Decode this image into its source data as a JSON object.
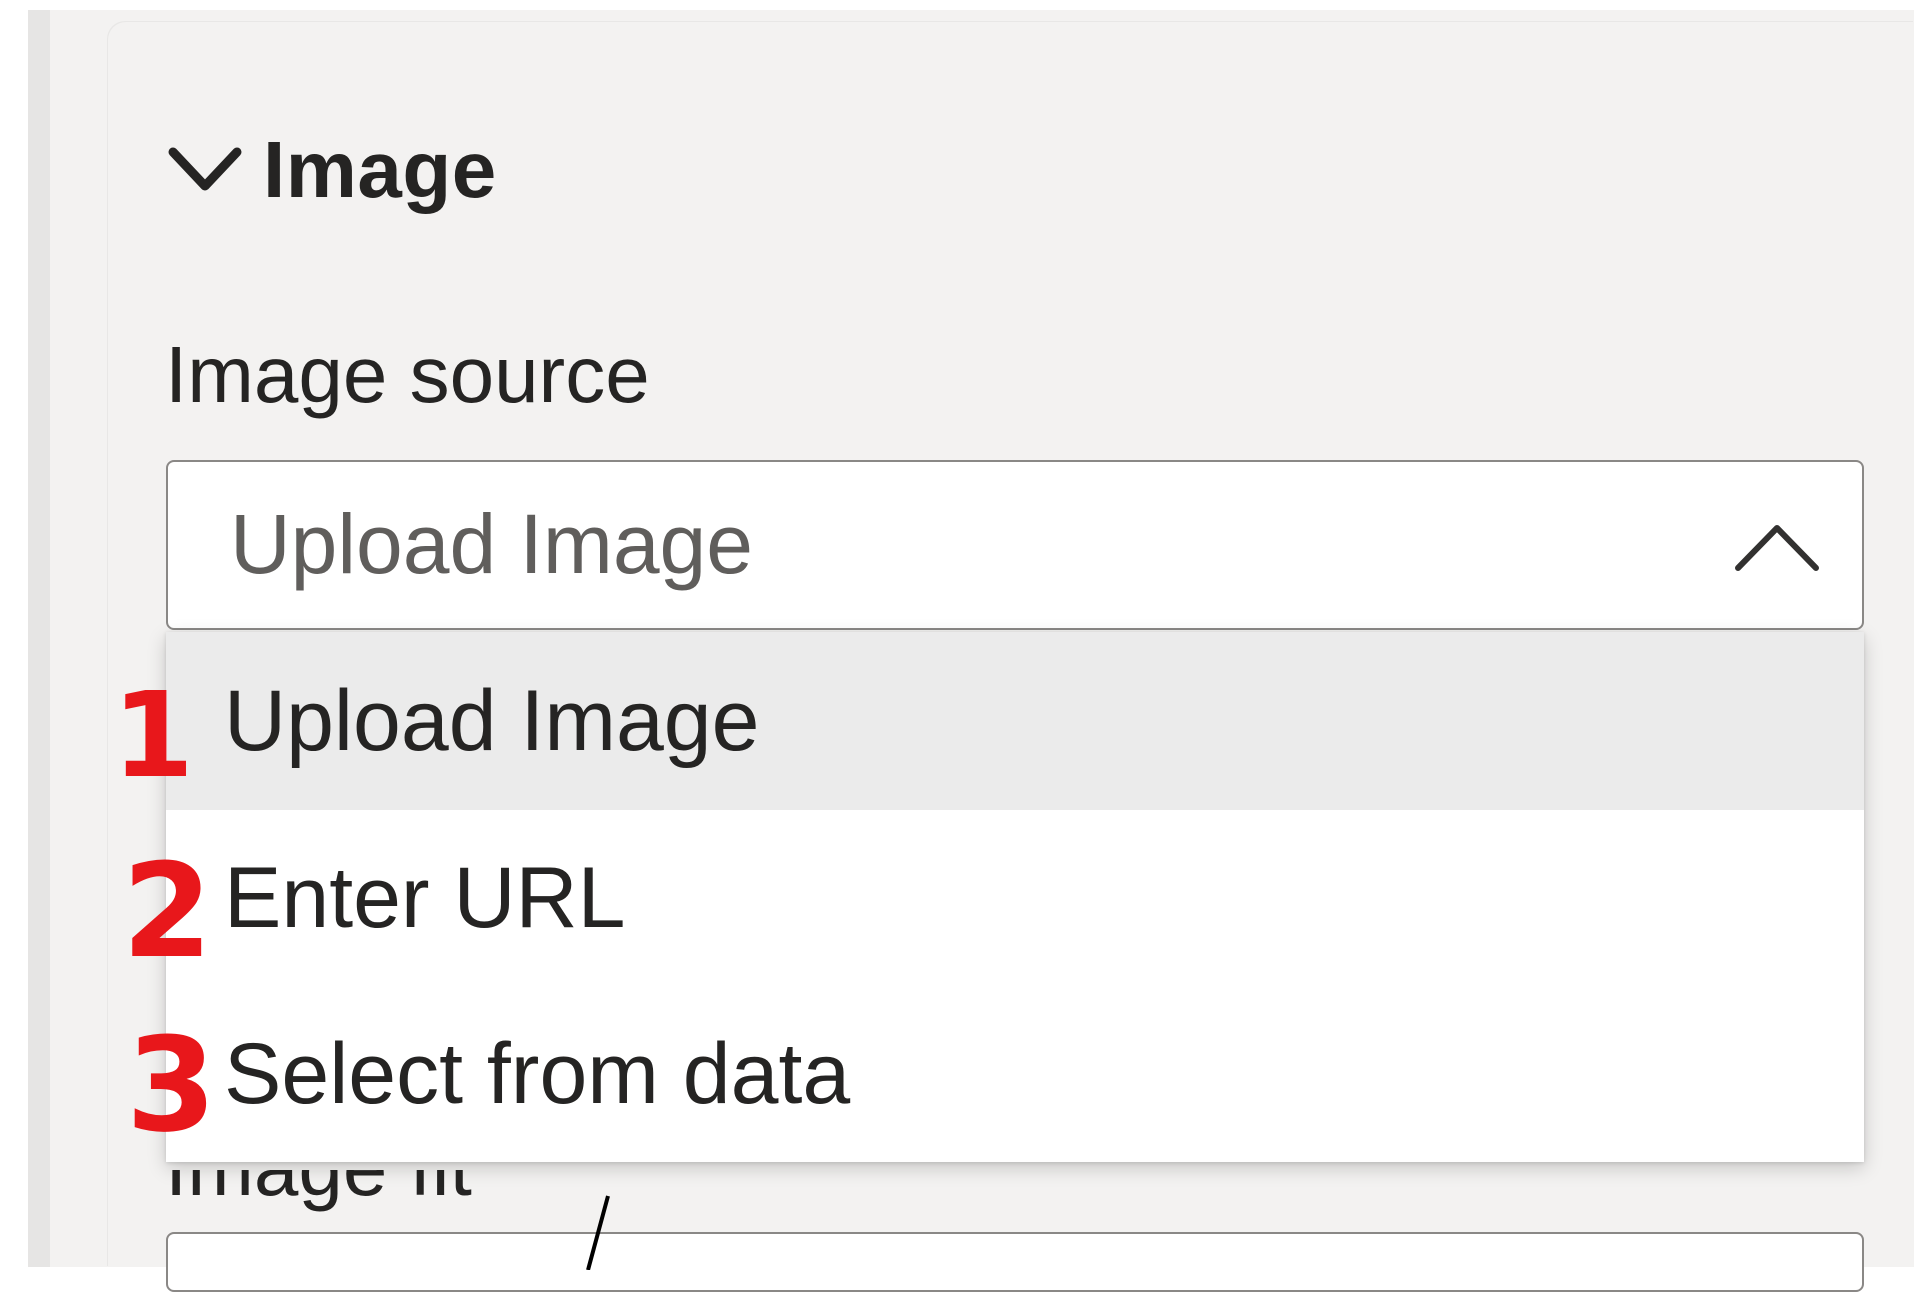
{
  "section": {
    "title": "Image",
    "icon": "chevron-down-icon"
  },
  "image_source": {
    "label": "Image source",
    "selected_value": "Upload Image",
    "toggle_icon": "chevron-up-icon",
    "options": [
      {
        "label": "Upload Image",
        "selected": true
      },
      {
        "label": "Enter URL",
        "selected": false
      },
      {
        "label": "Select from data",
        "selected": false
      }
    ]
  },
  "annotations": [
    "1",
    "2",
    "3"
  ],
  "colors": {
    "panel_bg": "#f3f2f1",
    "text": "#252423",
    "muted_text": "#605e5c",
    "selected_row": "#ebebeb",
    "annotation": "#e8171b"
  }
}
